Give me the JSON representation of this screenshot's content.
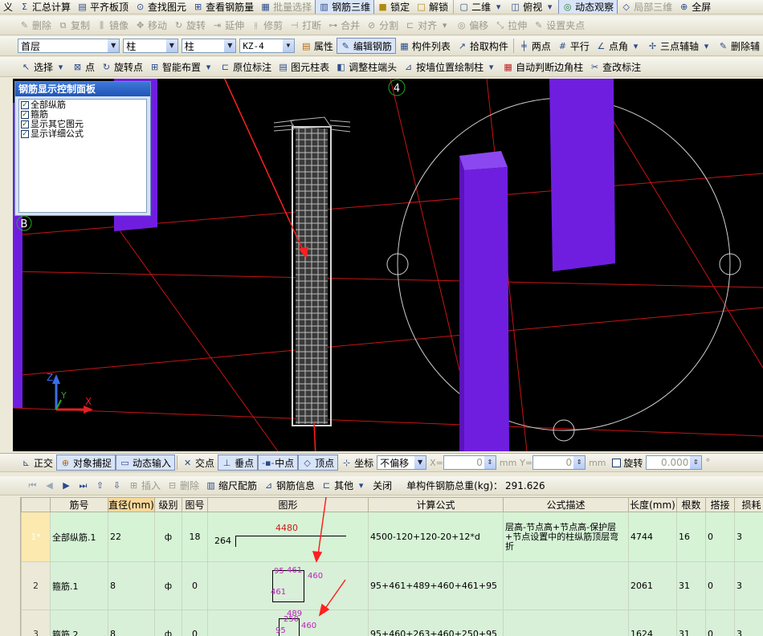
{
  "menu": {
    "items": [
      {
        "label": "义",
        "disabled": false
      },
      {
        "label": "汇总计算",
        "disabled": false
      },
      {
        "label": "平齐板顶",
        "disabled": false
      },
      {
        "label": "查找图元",
        "disabled": false
      },
      {
        "label": "查看钢筋量",
        "disabled": false
      },
      {
        "label": "批量选择",
        "disabled": true
      },
      {
        "label": "钢筋三维",
        "disabled": false
      },
      {
        "label": "锁定",
        "disabled": false
      },
      {
        "label": "解锁",
        "disabled": false
      },
      {
        "label": "二维",
        "disabled": false
      },
      {
        "label": "俯视",
        "disabled": false
      },
      {
        "label": "动态观察",
        "disabled": false
      },
      {
        "label": "局部三维",
        "disabled": true
      },
      {
        "label": "全屏",
        "disabled": false
      }
    ]
  },
  "edit_toolbar": {
    "items": [
      {
        "label": "删除",
        "disabled": true
      },
      {
        "label": "复制",
        "disabled": true
      },
      {
        "label": "镜像",
        "disabled": true
      },
      {
        "label": "移动",
        "disabled": true
      },
      {
        "label": "旋转",
        "disabled": true
      },
      {
        "label": "延伸",
        "disabled": true
      },
      {
        "label": "修剪",
        "disabled": true
      },
      {
        "label": "打断",
        "disabled": true
      },
      {
        "label": "合并",
        "disabled": true
      },
      {
        "label": "分割",
        "disabled": true
      },
      {
        "label": "对齐",
        "disabled": true
      },
      {
        "label": "偏移",
        "disabled": true
      },
      {
        "label": "拉伸",
        "disabled": true
      },
      {
        "label": "设置夹点",
        "disabled": true
      }
    ]
  },
  "selector_toolbar": {
    "floor": "首层",
    "category": "柱",
    "type": "柱",
    "component": "KZ-4",
    "attr_label": "属性",
    "edit_rebar_label": "编辑钢筋",
    "component_list_label": "构件列表",
    "pick_label": "拾取构件",
    "two_point_label": "两点",
    "parallel_label": "平行",
    "point_angle_label": "点角",
    "three_point_label": "三点辅轴",
    "delete_aux_label": "删除辅"
  },
  "draw_toolbar": {
    "items": [
      "选择",
      "点",
      "旋转点",
      "智能布置",
      "原位标注",
      "图元柱表",
      "调整柱端头",
      "按墙位置绘制柱",
      "自动判断边角柱",
      "查改标注"
    ]
  },
  "viewport": {
    "axis_label_4": "4",
    "axis_label_b": "B",
    "axes": {
      "z": "Z",
      "y": "Y",
      "x": "X"
    },
    "colors": {
      "column": "#6f1ee0",
      "grid_line": "#c81414",
      "rebar": "#d8d8d8"
    }
  },
  "control_panel": {
    "title": "钢筋显示控制面板",
    "options": [
      {
        "label": "全部纵筋",
        "checked": true
      },
      {
        "label": "箍筋",
        "checked": true
      },
      {
        "label": "显示其它图元",
        "checked": true
      },
      {
        "label": "显示详细公式",
        "checked": true
      }
    ]
  },
  "snap_toolbar": {
    "ortho": "正交",
    "object_snap": "对象捕捉",
    "dynamic_input": "动态输入",
    "intersection": "交点",
    "perpendicular": "垂点",
    "midpoint": "中点",
    "vertex": "顶点",
    "coord": "坐标",
    "offset_mode": "不偏移",
    "x_label": "X=",
    "x_value": "0",
    "y_label": "Y=",
    "y_value": "0",
    "unit": "mm",
    "rotate_label": "旋转",
    "rotate_value": "0.000",
    "degree": "°"
  },
  "rebar_info_bar": {
    "insert": "插入",
    "delete": "删除",
    "scale": "缩尺配筋",
    "rebar_info": "钢筋信息",
    "other": "其他",
    "close": "关闭",
    "total_label": "单构件钢筋总重(kg)：",
    "total_value": "291.626"
  },
  "grid": {
    "headers": [
      "筋号",
      "直径(mm)",
      "级别",
      "图号",
      "图形",
      "计算公式",
      "公式描述",
      "长度(mm)",
      "根数",
      "搭接",
      "损耗"
    ],
    "rows": [
      {
        "num": "1*",
        "name": "全部纵筋.1",
        "dia": "22",
        "grade": "ф",
        "fig": "18",
        "shape_left": "264",
        "shape_top": "4480",
        "formula": "4500-120+120-20+12*d",
        "desc": "层高-节点高+节点高-保护层+节点设置中的柱纵筋顶层弯折",
        "length": "4744",
        "count": "16",
        "lap": "0",
        "loss": "3"
      },
      {
        "num": "2",
        "name": "箍筋.1",
        "dia": "8",
        "grade": "ф",
        "fig": "0",
        "shape_a": "95",
        "shape_b": "461",
        "shape_c": "461",
        "shape_d": "460",
        "formula": "95+461+489+460+461+95",
        "desc": "",
        "length": "2061",
        "count": "31",
        "lap": "0",
        "loss": "3"
      },
      {
        "num": "3",
        "name": "箍筋.2",
        "dia": "8",
        "grade": "ф",
        "fig": "0",
        "shape_a": "95",
        "shape_b": "250",
        "shape_c": "489",
        "shape_d": "460",
        "shape_e": "460",
        "formula": "95+460+263+460+250+95",
        "desc": "",
        "length": "1624",
        "count": "31",
        "lap": "0",
        "loss": "3"
      }
    ]
  }
}
